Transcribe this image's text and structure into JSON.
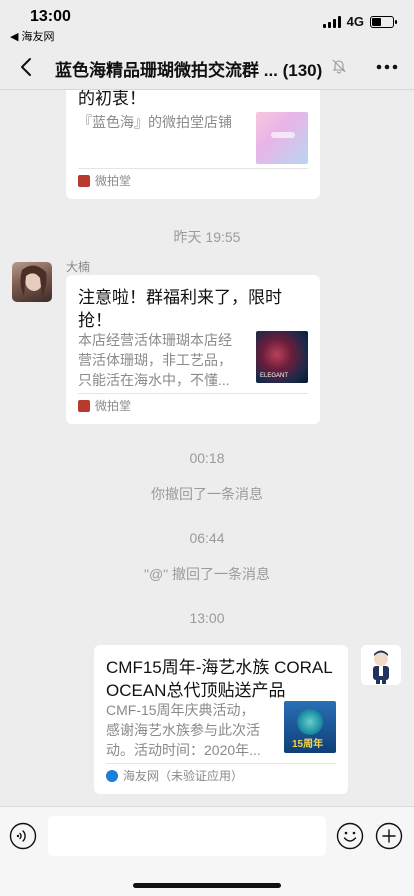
{
  "status": {
    "time": "13:00",
    "back_app": "◀ 海友网",
    "network": "4G",
    "battery_level": 0.45
  },
  "nav": {
    "title": "蓝色海精品珊瑚微拍交流群 ... (130)"
  },
  "messages": [
    {
      "type": "card",
      "title": "的初衷！",
      "desc": "『蓝色海』的微拍堂店铺",
      "source": "微拍堂"
    },
    {
      "type": "time",
      "text": "昨天 19:55"
    },
    {
      "type": "card",
      "sender": "大楠",
      "title_lines": [
        "注意啦！群福利来了，限时",
        "抢！"
      ],
      "desc_lines": [
        "本店经营活体珊瑚本店经",
        "营活体珊瑚，非工艺品，",
        "只能活在海水中，不懂..."
      ],
      "thumb_label": "ELEGANT",
      "source": "微拍堂"
    },
    {
      "type": "time",
      "text": "00:18"
    },
    {
      "type": "system",
      "text": "你撤回了一条消息"
    },
    {
      "type": "time",
      "text": "06:44"
    },
    {
      "type": "system",
      "text": "\"@\" 撤回了一条消息"
    },
    {
      "type": "time",
      "text": "13:00"
    },
    {
      "type": "card",
      "self": true,
      "title_lines": [
        "CMF15周年-海艺水族 CORAL",
        "OCEAN总代顶贴送产品"
      ],
      "desc_lines": [
        "CMF-15周年庆典活动，",
        "感谢海艺水族参与此次活",
        "动。活动时间：2020年..."
      ],
      "thumb_label": "15周年",
      "source": "海友网（未验证应用）"
    }
  ],
  "colors": {
    "background": "#ededed",
    "card": "#ffffff",
    "weipaitang": "#c0392b",
    "haiyou": "#1a7fd8"
  }
}
